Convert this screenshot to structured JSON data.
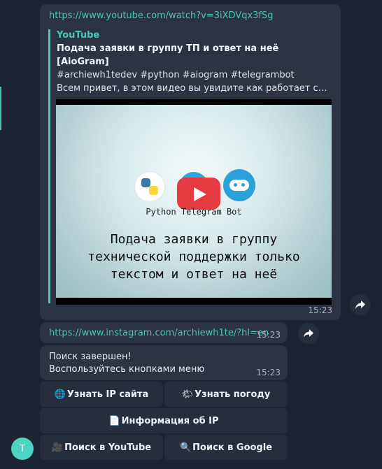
{
  "message1": {
    "url": "https://www.youtube.com/watch?v=3iXDVqx3fSg",
    "preview": {
      "site": "YouTube",
      "title": "Подача заявки в группу ТП и ответ на неё [AioGram]",
      "tags": "#archiewh1tedev #python #aiogram #telegrambot",
      "description": "Всем привет,  в этом видео вы увидите как работает система подачи заявки в группу технической поддержки только текстом и ответ на неё",
      "thumbnail": {
        "subtitle": "Python Telegram Bot",
        "caption": "Подача заявки в группу\nтехнической поддержки только\nтекстом и ответ на неё",
        "icons": [
          "python-logo-icon",
          "telegram-logo-icon",
          "bot-logo-icon",
          "play-icon"
        ]
      }
    },
    "time": "15:23"
  },
  "message2": {
    "url": "https://www.instagram.com/archiewh1te/?hl=en",
    "time": "15:23"
  },
  "message3": {
    "line1": "Поиск завершен!",
    "line2": "Воспользуйтесь кнопками меню",
    "time": "15:23"
  },
  "keyboard": {
    "site_ip": {
      "icon": "🌐",
      "label": "Узнать IP сайта"
    },
    "weather": {
      "icon": "🌤",
      "label": "Узнать погоду"
    },
    "ip_info": {
      "icon": "📄",
      "label": "Информация об IP"
    },
    "youtube": {
      "icon": "🎥",
      "label": "Поиск в YouTube"
    },
    "google": {
      "icon": "🔍",
      "label": "Поиск в Google"
    }
  },
  "avatar_letter": "T",
  "colors": {
    "background": "#1c2331",
    "bubble": "#2c3341",
    "accent": "#43c9b5",
    "play": "#e53a3f"
  }
}
